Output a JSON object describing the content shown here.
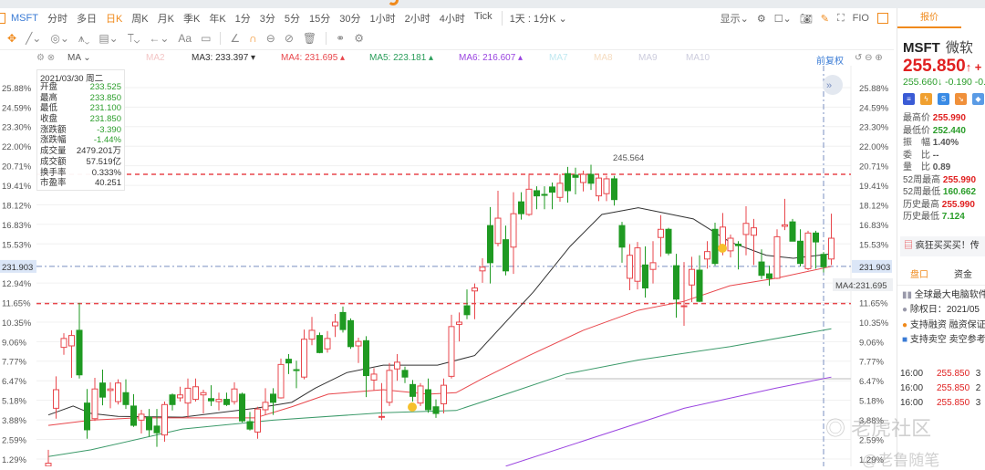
{
  "toolbar": {
    "symbol": "MSFT",
    "periods": [
      "分时",
      "多日",
      "日K",
      "周K",
      "月K",
      "季K",
      "年K",
      "1分",
      "3分",
      "5分",
      "15分",
      "30分",
      "1小时",
      "2小时",
      "4小时",
      "Tick"
    ],
    "active_period": "日K",
    "range": "1天 : 1分K ⌄",
    "display": "显示⌄",
    "f10": "FIO"
  },
  "drawing_tools": [
    "move",
    "line",
    "circle",
    "pattern",
    "fib",
    "text-level",
    "arrow",
    "Aa",
    "comment",
    "angle",
    "magnet",
    "eye",
    "hide",
    "trash",
    "link",
    "settings"
  ],
  "ma_bar": {
    "name": "MA ⌄",
    "ma2": "MA2",
    "ma3": "MA3: 233.397 ▾",
    "ma4": "MA4: 231.695 ▴",
    "ma5": "MA5: 223.181 ▴",
    "ma6": "MA6: 216.607 ▴",
    "ma7": "MA7",
    "ma8": "MA8",
    "ma9": "MA9",
    "ma10": "MA10",
    "adjust": "前复权"
  },
  "tooltip": {
    "date": "2021/03/30 周二",
    "rows": [
      [
        "开盘",
        "233.525"
      ],
      [
        "最高",
        "233.850"
      ],
      [
        "最低",
        "231.100"
      ],
      [
        "收盘",
        "231.850"
      ],
      [
        "涨跌额",
        "-3.390"
      ],
      [
        "涨跌幅",
        "-1.44%"
      ],
      [
        "成交量",
        "2479.201万"
      ],
      [
        "成交额",
        "57.519亿"
      ],
      [
        "换手率",
        "0.333%"
      ],
      [
        "市盈率",
        "40.251"
      ]
    ]
  },
  "colors": {
    "up": "#e8474c",
    "down": "#1f9a22",
    "ma3": "#333333",
    "ma4": "#e8474c",
    "ma5": "#3c9a6a",
    "ma6": "#9a44e0",
    "accent": "#f08a1c"
  },
  "chart_data": {
    "type": "candlestick",
    "price_axis": {
      "current_price_label": "231.903",
      "current_price": 231.903,
      "ma4_label": "MA4:231.695",
      "high_label": "245.564"
    },
    "pct_ticks": [
      "25.88%",
      "24.59%",
      "23.30%",
      "22.00%",
      "20.71%",
      "19.41%",
      "18.12%",
      "16.83%",
      "15.53%",
      "12.94%",
      "11.65%",
      "10.35%",
      "9.06%",
      "7.77%",
      "6.47%",
      "5.18%",
      "3.88%",
      "2.59%",
      "1.29%"
    ],
    "pct_base": 203.35,
    "support_resistance": [
      244.3,
      226.9
    ],
    "ohlc": [
      [
        205.0,
        207.2,
        204.9,
        205.4
      ],
      [
        212.8,
        217.1,
        211.4,
        215.3
      ],
      [
        221.0,
        222.9,
        220.0,
        222.2
      ],
      [
        221.2,
        223.3,
        216.9,
        222.6
      ],
      [
        223.3,
        227.0,
        216.8,
        217.3
      ],
      [
        213.5,
        215.4,
        208.7,
        209.9
      ],
      [
        211.4,
        216.9,
        211.1,
        215.4
      ],
      [
        216.2,
        218.0,
        213.2,
        214.3
      ],
      [
        215.2,
        216.3,
        212.8,
        215.4
      ],
      [
        213.7,
        216.7,
        213.3,
        216.2
      ],
      [
        214.9,
        216.7,
        212.7,
        213.3
      ],
      [
        213.1,
        214.7,
        210.3,
        210.5
      ],
      [
        211.2,
        212.6,
        209.4,
        212.0
      ],
      [
        211.6,
        212.7,
        209.0,
        209.9
      ],
      [
        210.4,
        212.7,
        207.6,
        209.5
      ],
      [
        209.2,
        213.7,
        208.3,
        213.3
      ],
      [
        214.6,
        214.8,
        212.5,
        213.3
      ],
      [
        214.2,
        215.7,
        213.7,
        214.6
      ],
      [
        213.5,
        216.8,
        211.5,
        215.5
      ],
      [
        214.0,
        216.8,
        213.7,
        215.7
      ],
      [
        214.6,
        215.3,
        212.1,
        214.9
      ],
      [
        214.1,
        215.9,
        213.1,
        213.8
      ],
      [
        213.7,
        214.9,
        212.5,
        214.0
      ],
      [
        214.0,
        214.9,
        213.1,
        213.3
      ],
      [
        213.7,
        216.3,
        213.3,
        215.4
      ],
      [
        214.7,
        214.9,
        210.9,
        211.1
      ],
      [
        211.0,
        212.3,
        209.8,
        210.0
      ],
      [
        209.6,
        213.0,
        208.7,
        212.7
      ],
      [
        212.6,
        215.5,
        211.9,
        213.6
      ],
      [
        214.7,
        215.5,
        211.9,
        213.6
      ],
      [
        214.2,
        219.5,
        214.1,
        218.7
      ],
      [
        219.4,
        220.1,
        217.4,
        218.9
      ],
      [
        218.0,
        219.2,
        215.5,
        217.9
      ],
      [
        217.0,
        223.4,
        216.7,
        222.1
      ],
      [
        222.1,
        225.1,
        221.3,
        223.3
      ],
      [
        222.6,
        223.0,
        220.2,
        220.3
      ],
      [
        220.8,
        223.2,
        220.3,
        222.2
      ],
      [
        223.9,
        225.5,
        222.4,
        224.4
      ],
      [
        225.7,
        226.5,
        223.0,
        223.4
      ],
      [
        224.6,
        224.9,
        220.8,
        221.1
      ],
      [
        221.2,
        222.3,
        218.9,
        221.8
      ],
      [
        221.9,
        222.5,
        214.3,
        217.2
      ],
      [
        216.6,
        218.2,
        215.2,
        217.4
      ],
      [
        211.6,
        216.2,
        211.2,
        211.7
      ],
      [
        213.6,
        218.9,
        213.1,
        217.9
      ],
      [
        218.1,
        220.1,
        216.5,
        219.0
      ],
      [
        217.9,
        218.4,
        216.2,
        217.0
      ],
      [
        216.0,
        216.6,
        213.7,
        214.4
      ],
      [
        213.5,
        216.2,
        213.1,
        215.8
      ],
      [
        215.3,
        216.8,
        212.2,
        212.6
      ],
      [
        213.0,
        214.0,
        211.5,
        212.1
      ],
      [
        213.4,
        216.8,
        212.1,
        215.9
      ],
      [
        217.1,
        225.4,
        216.8,
        223.8
      ],
      [
        224.1,
        225.7,
        221.8,
        224.4
      ],
      [
        226.6,
        228.8,
        224.8,
        225.4
      ],
      [
        228.6,
        229.6,
        224.8,
        229.0
      ],
      [
        231.3,
        233.0,
        229.7,
        231.8
      ],
      [
        237.4,
        239.9,
        229.6,
        232.4
      ],
      [
        235.0,
        242.1,
        234.6,
        238.4
      ],
      [
        235.5,
        237.4,
        230.7,
        231.3
      ],
      [
        234.5,
        241.9,
        230.9,
        239.0
      ],
      [
        240.6,
        241.9,
        238.2,
        239.0
      ],
      [
        238.9,
        244.4,
        238.7,
        242.3
      ],
      [
        242.1,
        242.7,
        239.6,
        241.4
      ],
      [
        241.6,
        242.7,
        239.6,
        241.5
      ],
      [
        242.6,
        243.2,
        239.6,
        241.9
      ],
      [
        241.2,
        244.3,
        240.6,
        243.1
      ],
      [
        244.4,
        245.3,
        240.5,
        242.1
      ],
      [
        244.2,
        245.2,
        241.6,
        243.9
      ],
      [
        243.2,
        244.8,
        242.0,
        244.3
      ],
      [
        244.3,
        245.6,
        242.2,
        243.1
      ],
      [
        241.4,
        244.3,
        240.7,
        243.8
      ],
      [
        241.7,
        244.1,
        240.7,
        243.7
      ],
      [
        243.7,
        244.1,
        240.1,
        240.9
      ],
      [
        237.4,
        237.9,
        232.4,
        234.5
      ],
      [
        230.3,
        234.9,
        228.7,
        233.4
      ],
      [
        229.9,
        235.2,
        228.8,
        234.4
      ],
      [
        232.1,
        234.6,
        227.7,
        229.0
      ],
      [
        231.5,
        235.3,
        229.6,
        232.4
      ],
      [
        235.8,
        238.8,
        233.2,
        236.9
      ],
      [
        236.9,
        237.1,
        233.4,
        233.7
      ],
      [
        232.0,
        233.6,
        225.0,
        227.5
      ],
      [
        226.5,
        232.5,
        223.9,
        226.6
      ],
      [
        229.4,
        233.2,
        227.1,
        231.5
      ],
      [
        231.4,
        233.4,
        227.1,
        227.2
      ],
      [
        232.9,
        235.3,
        231.6,
        233.9
      ],
      [
        236.9,
        237.8,
        232.0,
        232.3
      ],
      [
        234.6,
        239.1,
        233.4,
        237.2
      ],
      [
        234.0,
        236.2,
        233.1,
        235.7
      ],
      [
        234.9,
        235.3,
        231.5,
        234.7
      ],
      [
        236.2,
        240.0,
        233.4,
        237.7
      ],
      [
        236.1,
        238.3,
        232.1,
        237.1
      ],
      [
        232.5,
        234.2,
        230.2,
        230.7
      ],
      [
        230.9,
        232.0,
        229.3,
        230.3
      ],
      [
        230.3,
        236.9,
        230.2,
        235.9
      ],
      [
        237.3,
        241.0,
        236.8,
        237.5
      ],
      [
        237.9,
        238.3,
        235.3,
        235.3
      ],
      [
        235.3,
        236.9,
        231.9,
        232.3
      ],
      [
        231.6,
        236.7,
        231.4,
        236.4
      ],
      [
        236.4,
        236.7,
        231.6,
        235.2
      ],
      [
        233.525,
        233.85,
        231.1,
        231.85
      ],
      [
        232.9,
        239.0,
        232.1,
        235.7
      ]
    ],
    "ma_lines": {
      "MA3": [
        [
          0,
          211.9
        ],
        [
          3.2,
          213.1
        ],
        [
          5.5,
          212.1
        ],
        [
          9,
          211.7
        ],
        [
          17.3,
          211.6
        ],
        [
          26.7,
          212.8
        ],
        [
          31.4,
          213.6
        ],
        [
          34.4,
          215.5
        ],
        [
          38.5,
          217.6
        ],
        [
          43.2,
          218.6
        ],
        [
          50.2,
          218.6
        ],
        [
          55,
          219.9
        ],
        [
          62.6,
          228.5
        ],
        [
          67.3,
          234.6
        ],
        [
          71.4,
          238.9
        ],
        [
          76.1,
          239.8
        ],
        [
          78.5,
          239.3
        ],
        [
          83.2,
          238.3
        ],
        [
          87.9,
          235.2
        ],
        [
          92.6,
          233.4
        ],
        [
          96.1,
          233.0
        ],
        [
          101,
          233.6
        ]
      ],
      "MA4": [
        [
          0,
          210.5
        ],
        [
          5.5,
          211.2
        ],
        [
          11.4,
          211.5
        ],
        [
          26.7,
          211.5
        ],
        [
          31.4,
          213.0
        ],
        [
          36.1,
          214.7
        ],
        [
          43.2,
          215.3
        ],
        [
          49,
          214.7
        ],
        [
          52.6,
          214.9
        ],
        [
          56,
          216.8
        ],
        [
          62,
          219.9
        ],
        [
          69,
          223.3
        ],
        [
          76.1,
          226.0
        ],
        [
          82,
          227.2
        ],
        [
          87.9,
          229.3
        ],
        [
          93.8,
          230.3
        ],
        [
          101,
          231.9
        ]
      ],
      "MA5": [
        [
          0,
          206.3
        ],
        [
          5.5,
          207.2
        ],
        [
          17.3,
          210.0
        ],
        [
          29,
          211.2
        ],
        [
          43.2,
          212.2
        ],
        [
          52.6,
          212.5
        ],
        [
          59.6,
          214.9
        ],
        [
          66.7,
          217.4
        ],
        [
          76.1,
          219.3
        ],
        [
          87.9,
          221.1
        ],
        [
          101,
          223.5
        ]
      ],
      "MA6": [
        [
          59,
          205.0
        ],
        [
          70.2,
          208.8
        ],
        [
          82,
          212.8
        ],
        [
          93.8,
          215.5
        ],
        [
          101,
          217.0
        ]
      ]
    }
  },
  "quote_panel": {
    "tab": "报价",
    "symbol": "MSFT",
    "name": "微软",
    "price": "255.850",
    "price_arrow": "↑ +",
    "sub": "255.660↓ -0.190 -0.",
    "stats": [
      [
        "最高价",
        "255.990",
        "red"
      ],
      [
        "最低价",
        "252.440",
        "grn"
      ],
      [
        "振　幅",
        "1.40%",
        ""
      ],
      [
        "委　比",
        "--",
        ""
      ],
      [
        "量　比",
        "0.89",
        ""
      ],
      [
        "52周最高",
        "255.990",
        "red"
      ],
      [
        "52周最低",
        "160.662",
        "grn"
      ],
      [
        "历史最高",
        "255.990",
        "red"
      ],
      [
        "历史最低",
        "7.124",
        "grn"
      ]
    ],
    "banner": "疯狂买买买！传",
    "tabs": [
      "盘口",
      "资金"
    ],
    "info": [
      "全球最大电脑软件",
      "除权日：2021/05",
      "支持融资 融资保证",
      "支持卖空 卖空参考"
    ],
    "trades": [
      [
        "16:00",
        "255.850",
        "3"
      ],
      [
        "16:00",
        "255.850",
        "2"
      ],
      [
        "16:00",
        "255.850",
        "3"
      ]
    ]
  },
  "watermark": {
    "text1": "老虎社区",
    "text2": "@老鲁随笔"
  }
}
